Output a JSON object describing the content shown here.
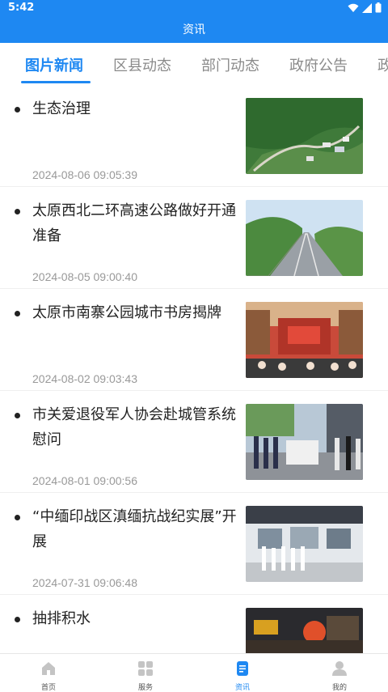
{
  "status_bar": {
    "time": "5:42"
  },
  "header": {
    "title": "资讯"
  },
  "tabs": [
    {
      "label": "图片新闻",
      "active": true
    },
    {
      "label": "区县动态",
      "active": false
    },
    {
      "label": "部门动态",
      "active": false
    },
    {
      "label": "政府公告",
      "active": false
    },
    {
      "label": "政",
      "active": false
    }
  ],
  "articles": [
    {
      "title": "生态治理",
      "date": "2024-08-06 09:05:39"
    },
    {
      "title": "太原西北二环高速公路做好开通准备",
      "date": "2024-08-05 09:00:40"
    },
    {
      "title": "太原市南寨公园城市书房揭牌",
      "date": "2024-08-02 09:03:43"
    },
    {
      "title": "市关爱退役军人协会赴城管系统慰问",
      "date": "2024-08-01 09:00:56"
    },
    {
      "title": "“中缅印战区滇缅抗战纪实展”开展",
      "date": "2024-07-31 09:06:48"
    },
    {
      "title": "抽排积水",
      "date": ""
    }
  ],
  "bottom_nav": [
    {
      "label": "首页",
      "icon": "home-icon",
      "active": false
    },
    {
      "label": "服务",
      "icon": "grid-icon",
      "active": false
    },
    {
      "label": "资讯",
      "icon": "news-icon",
      "active": true
    },
    {
      "label": "我的",
      "icon": "user-icon",
      "active": false
    }
  ],
  "colors": {
    "primary": "#1e88f2",
    "text": "#222222",
    "muted": "#999999",
    "tab_inactive": "#8a8a8a"
  }
}
